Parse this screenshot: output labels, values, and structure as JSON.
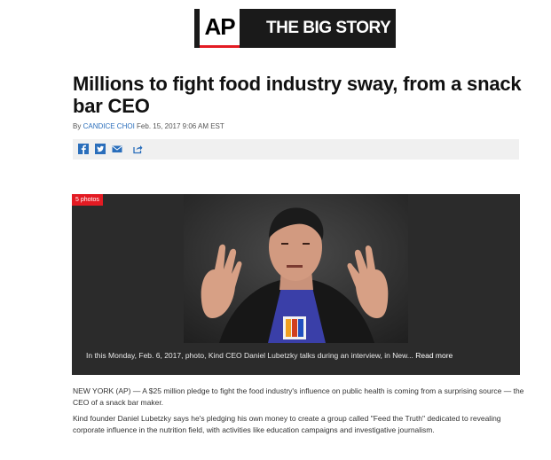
{
  "brand": {
    "logo_text": "AP",
    "section_text": "THE BIG STORY",
    "accent_color": "#e31b23"
  },
  "article": {
    "headline": "Millions to fight food industry sway, from a snack bar CEO",
    "byline_prefix": "By",
    "author": "CANDICE CHOI",
    "timestamp": "Feb. 15, 2017 9:06 AM EST"
  },
  "share": {
    "icons": [
      "facebook-icon",
      "twitter-icon",
      "email-icon",
      "share-icon"
    ]
  },
  "gallery": {
    "photo_count": "5 photos",
    "caption": "In this Monday, Feb. 6, 2017, photo, Kind CEO Daniel Lubetzky talks during an interview, in New...",
    "read_more": "Read more"
  },
  "body": {
    "paragraphs": [
      "NEW YORK (AP) — A $25 million pledge to fight the food industry's influence on public health is coming from a surprising source — the CEO of a snack bar maker.",
      "Kind founder Daniel Lubetzky says he's pledging his own money to create a group called \"Feed the Truth\" dedicated to revealing corporate influence in the nutrition field, with activities like education campaigns and investigative journalism."
    ]
  }
}
